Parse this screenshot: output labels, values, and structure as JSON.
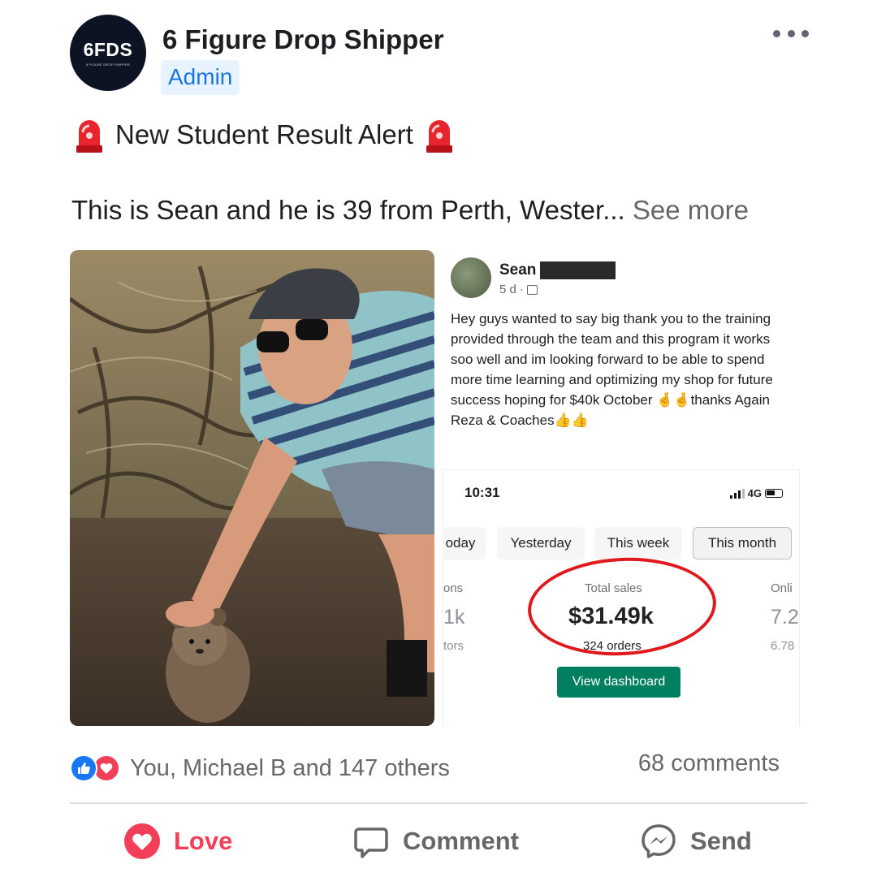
{
  "post": {
    "page_name": "6 Figure Drop Shipper",
    "badge": "Admin",
    "avatar_text": "6FDS",
    "avatar_subtext": "6 FIGURE DROP SHIPPER",
    "alert_text": "New Student Result Alert",
    "body_text": "This is Sean and he is 39 from Perth, Wester...",
    "see_more": "See more"
  },
  "screenshot": {
    "author": "Sean",
    "time": "5 d ·",
    "post_text": "Hey guys wanted to say big thank you to the training provided through the team and this program it works soo well and im looking forward to be able to spend more time learning and optimizing my shop for future success hoping for $40k October 🤞🤞thanks Again Reza & Coaches👍👍",
    "phone_time": "10:31",
    "network": "4G",
    "tabs": [
      "oday",
      "Yesterday",
      "This week",
      "This month"
    ],
    "active_tab": "This month",
    "metric_left_label": "ons",
    "metric_left_value": "1k",
    "metric_left_sub": "tors",
    "metric_label": "Total sales",
    "metric_value": "$31.49k",
    "metric_sub": "324 orders",
    "metric_right_label": "Onli",
    "metric_right_value": "7.2",
    "metric_right_sub": "6.78",
    "button": "View dashboard"
  },
  "footer": {
    "reactions_text": "You, Michael B and 147 others",
    "comments": "68 comments",
    "love_label": "Love",
    "comment_label": "Comment",
    "send_label": "Send"
  },
  "colors": {
    "facebook_blue": "#1877f2",
    "love_red": "#f33e58",
    "shopify_green": "#008060",
    "highlight_red": "#e0191e"
  }
}
